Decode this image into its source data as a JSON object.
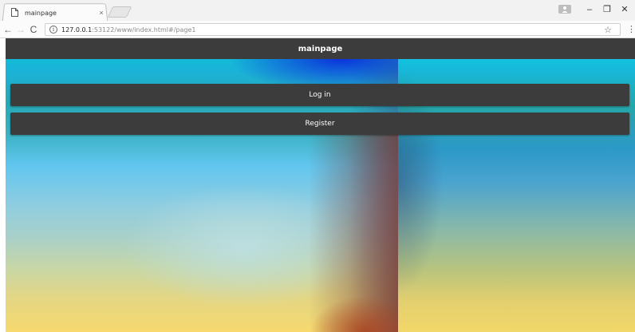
{
  "browser": {
    "tab": {
      "title": "mainpage",
      "favicon": "page-icon",
      "close_glyph": "×"
    },
    "window_controls": {
      "minimize": "–",
      "maximize": "❐",
      "close": "✕"
    },
    "nav": {
      "back": "←",
      "forward": "→",
      "reload": "C"
    },
    "address": {
      "info_glyph": "i",
      "host": "127.0.0.1",
      "rest": ":53122/www/index.html#/page1"
    },
    "bookmark_glyph": "☆",
    "menu_glyph": "⋮"
  },
  "app": {
    "header_title": "mainpage",
    "buttons": {
      "login": "Log in",
      "register": "Register"
    },
    "colors": {
      "header_bg": "#3c3c3c",
      "button_bg": "#3c3c3c",
      "text": "#ffffff"
    }
  }
}
